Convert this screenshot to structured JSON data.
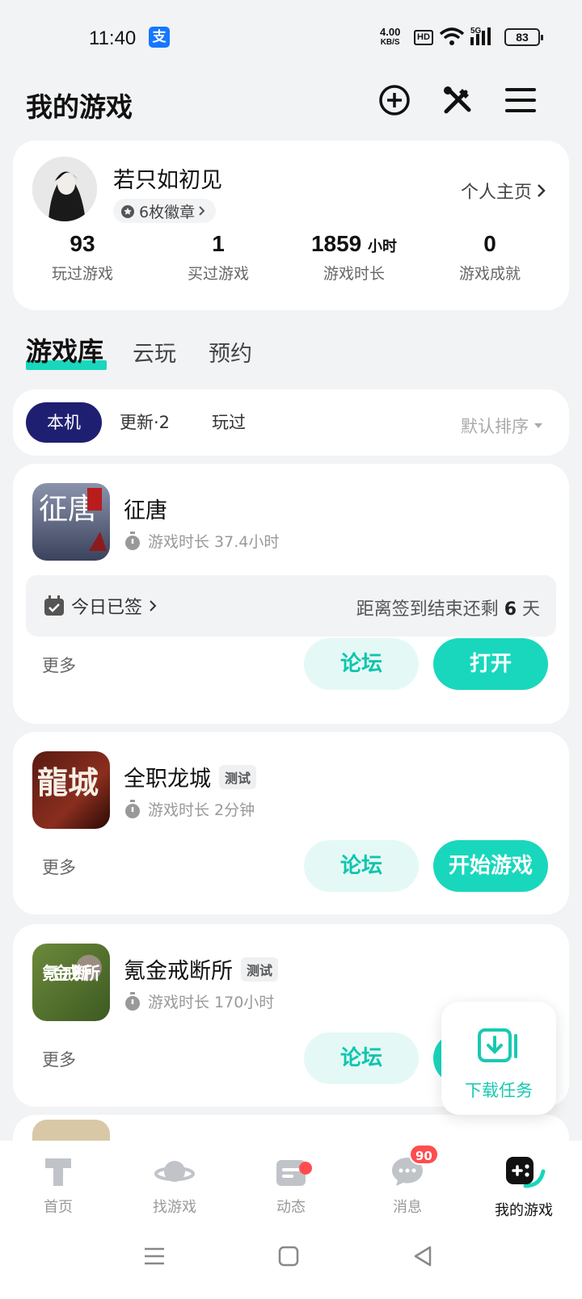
{
  "status_bar": {
    "time": "11:40",
    "alipay": "支",
    "speed_top": "4.00",
    "speed_unit": "KB/S",
    "hd": "HD",
    "network": "5G",
    "battery": "83"
  },
  "header": {
    "title": "我的游戏",
    "icons": [
      "add-circle-icon",
      "tools-icon",
      "menu-icon"
    ]
  },
  "profile": {
    "username": "若只如初见",
    "badges": "6枚徽章",
    "homepage_link": "个人主页",
    "stats": [
      {
        "value": "93",
        "unit": "",
        "label": "玩过游戏"
      },
      {
        "value": "1",
        "unit": "",
        "label": "买过游戏"
      },
      {
        "value": "1859",
        "unit": "小时",
        "label": "游戏时长"
      },
      {
        "value": "0",
        "unit": "",
        "label": "游戏成就"
      }
    ]
  },
  "main_tabs": [
    {
      "label": "游戏库",
      "active": true
    },
    {
      "label": "云玩"
    },
    {
      "label": "预约"
    }
  ],
  "filters": {
    "chips": [
      "本机",
      "更新·2",
      "玩过"
    ],
    "sort": "默认排序"
  },
  "games": [
    {
      "name": "征唐",
      "tag": "",
      "playtime": "游戏时长 37.4小时",
      "icon_text": "征唐",
      "checkin": {
        "label": "今日已签",
        "remaining_prefix": "距离签到结束还剩 ",
        "remaining_days": "6",
        "remaining_suffix": " 天"
      },
      "more": "更多",
      "forum": "论坛",
      "action": "打开"
    },
    {
      "name": "全职龙城",
      "tag": "测试",
      "playtime": "游戏时长 2分钟",
      "icon_text": "龍城",
      "more": "更多",
      "forum": "论坛",
      "action": "开始游戏"
    },
    {
      "name": "氪金戒断所",
      "tag": "测试",
      "playtime": "游戏时长 170小时",
      "icon_text": "氪金戒断所",
      "more": "更多",
      "forum": "论坛",
      "action": ""
    }
  ],
  "float_download": {
    "label": "下载任务"
  },
  "bottom_nav": [
    {
      "label": "首页",
      "icon": "home-icon"
    },
    {
      "label": "找游戏",
      "icon": "planet-icon"
    },
    {
      "label": "动态",
      "icon": "feed-icon"
    },
    {
      "label": "消息",
      "icon": "message-icon",
      "badge": "90"
    },
    {
      "label": "我的游戏",
      "icon": "gamepad-icon",
      "active": true
    }
  ],
  "colors": {
    "accent": "#19d7bd",
    "chip_active": "#1f1f72",
    "badge": "#ff4d4f"
  }
}
